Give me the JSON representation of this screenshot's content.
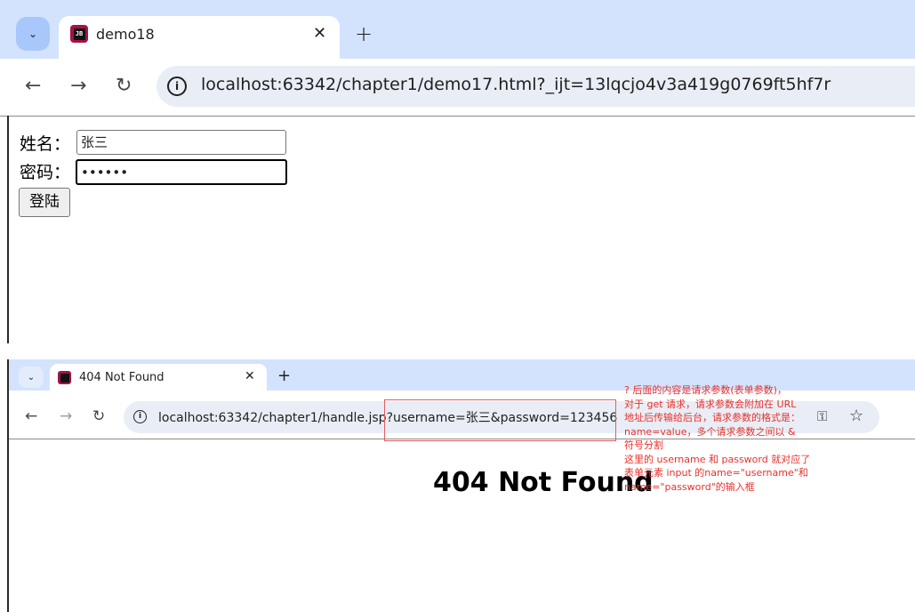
{
  "window1": {
    "tab_title": "demo18",
    "tab_close": "✕",
    "new_tab": "+",
    "url_host": "localhost",
    "url_rest": ":63342/chapter1/demo17.html?_ijt=13lqcjo4v3a419g0769ft5hf7r",
    "form": {
      "name_label": "姓名：",
      "name_value": "张三",
      "password_label": "密码：",
      "password_value": "••••••",
      "submit_label": "登陆"
    }
  },
  "window2": {
    "tab_title": "404 Not Found",
    "tab_close": "✕",
    "new_tab": "+",
    "url": "localhost:63342/chapter1/handle.jsp?username=张三&password=123456",
    "heading": "404 Not Found"
  },
  "annotation": "? 后面的内容是请求参数(表单参数)，\n对于 get 请求，请求参数会附加在 URL\n地址后传输给后台，请求参数的格式是：\nname=value，多个请求参数之间以 &\n符号分割\n这里的 username 和 password 就对应了\n表单元素 input 的name=\"username\"和\nname=\"password\"的输入框",
  "icons": [
    "tab-list-icon",
    "jetbrains-icon",
    "back-icon",
    "forward-icon",
    "reload-icon",
    "site-info-icon",
    "password-key-icon",
    "bookmark-star-icon"
  ],
  "colors": {
    "tab_strip": "#d3e3fd",
    "omnibox": "#e9eef6",
    "annotation_red": "#e8302a"
  }
}
